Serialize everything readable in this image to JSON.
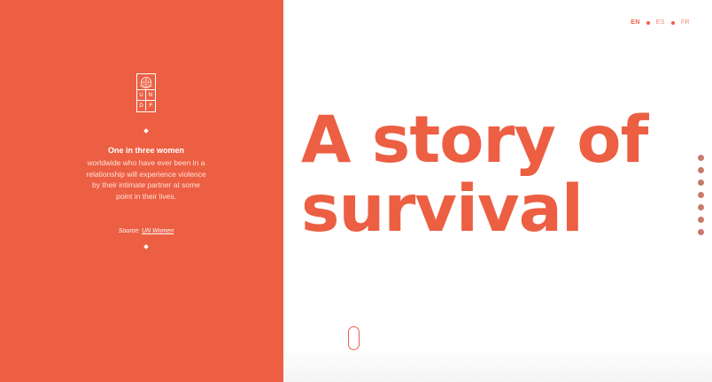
{
  "brand": {
    "accent": "#ec5f43",
    "logo_letters": [
      "U",
      "N",
      "D",
      "P"
    ]
  },
  "languages": [
    {
      "code": "EN",
      "active": true
    },
    {
      "code": "ES",
      "active": false
    },
    {
      "code": "FR",
      "active": false
    }
  ],
  "sidebar": {
    "stat_highlight": "One in three women",
    "stat_text": "worldwide who have ever been in a relationship will experience violence by their intimate partner at some point in their lives.",
    "source_prefix": "Source:",
    "source_link": "UN Women"
  },
  "hero": {
    "title_line1": "A story of",
    "title_line2": "survival"
  },
  "section_nav": {
    "count": 7
  }
}
